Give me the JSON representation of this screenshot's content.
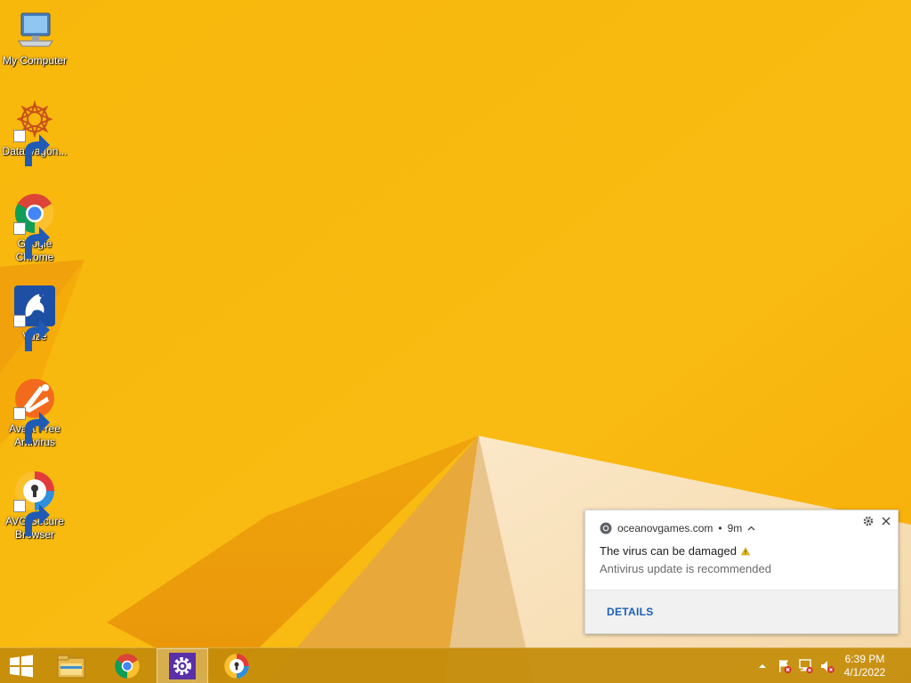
{
  "desktop": {
    "icons": [
      {
        "label": "My Computer",
        "icon": "computer-icon"
      },
      {
        "label": "DataWagon...",
        "icon": "datawagon-icon"
      },
      {
        "label": "Google Chrome",
        "icon": "chrome-icon"
      },
      {
        "label": "Vuze",
        "icon": "vuze-icon"
      },
      {
        "label": "Avast Free Antivirus",
        "icon": "avast-icon"
      },
      {
        "label": "AVG Secure Browser",
        "icon": "avg-browser-icon"
      }
    ]
  },
  "notification": {
    "source": "oceanovgames.com",
    "time": "9m",
    "title": "The virus can be damaged",
    "message": "Antivirus update is recommended",
    "button": "DETAILS",
    "settings_icon": "gear-icon",
    "close_icon": "close-icon",
    "warning_icon": "warning-icon"
  },
  "taskbar": {
    "start_icon": "windows-logo-icon",
    "pinned": [
      {
        "name": "file-explorer",
        "icon": "folder-icon"
      },
      {
        "name": "chrome",
        "icon": "chrome-icon"
      },
      {
        "name": "settings",
        "icon": "gear-icon",
        "active": true
      },
      {
        "name": "avg-secure-browser",
        "icon": "avg-browser-icon"
      }
    ],
    "tray": {
      "overflow_icon": "chevron-up-icon",
      "action_center_icon": "flag-error-icon",
      "network_icon": "network-error-icon",
      "volume_icon": "volume-muted-icon"
    },
    "clock": {
      "time": "6:39 PM",
      "date": "4/1/2022"
    }
  },
  "colors": {
    "wallpaper": "#f7b708",
    "taskbar": "#c48c0a",
    "link_blue": "#1a5fb4"
  }
}
